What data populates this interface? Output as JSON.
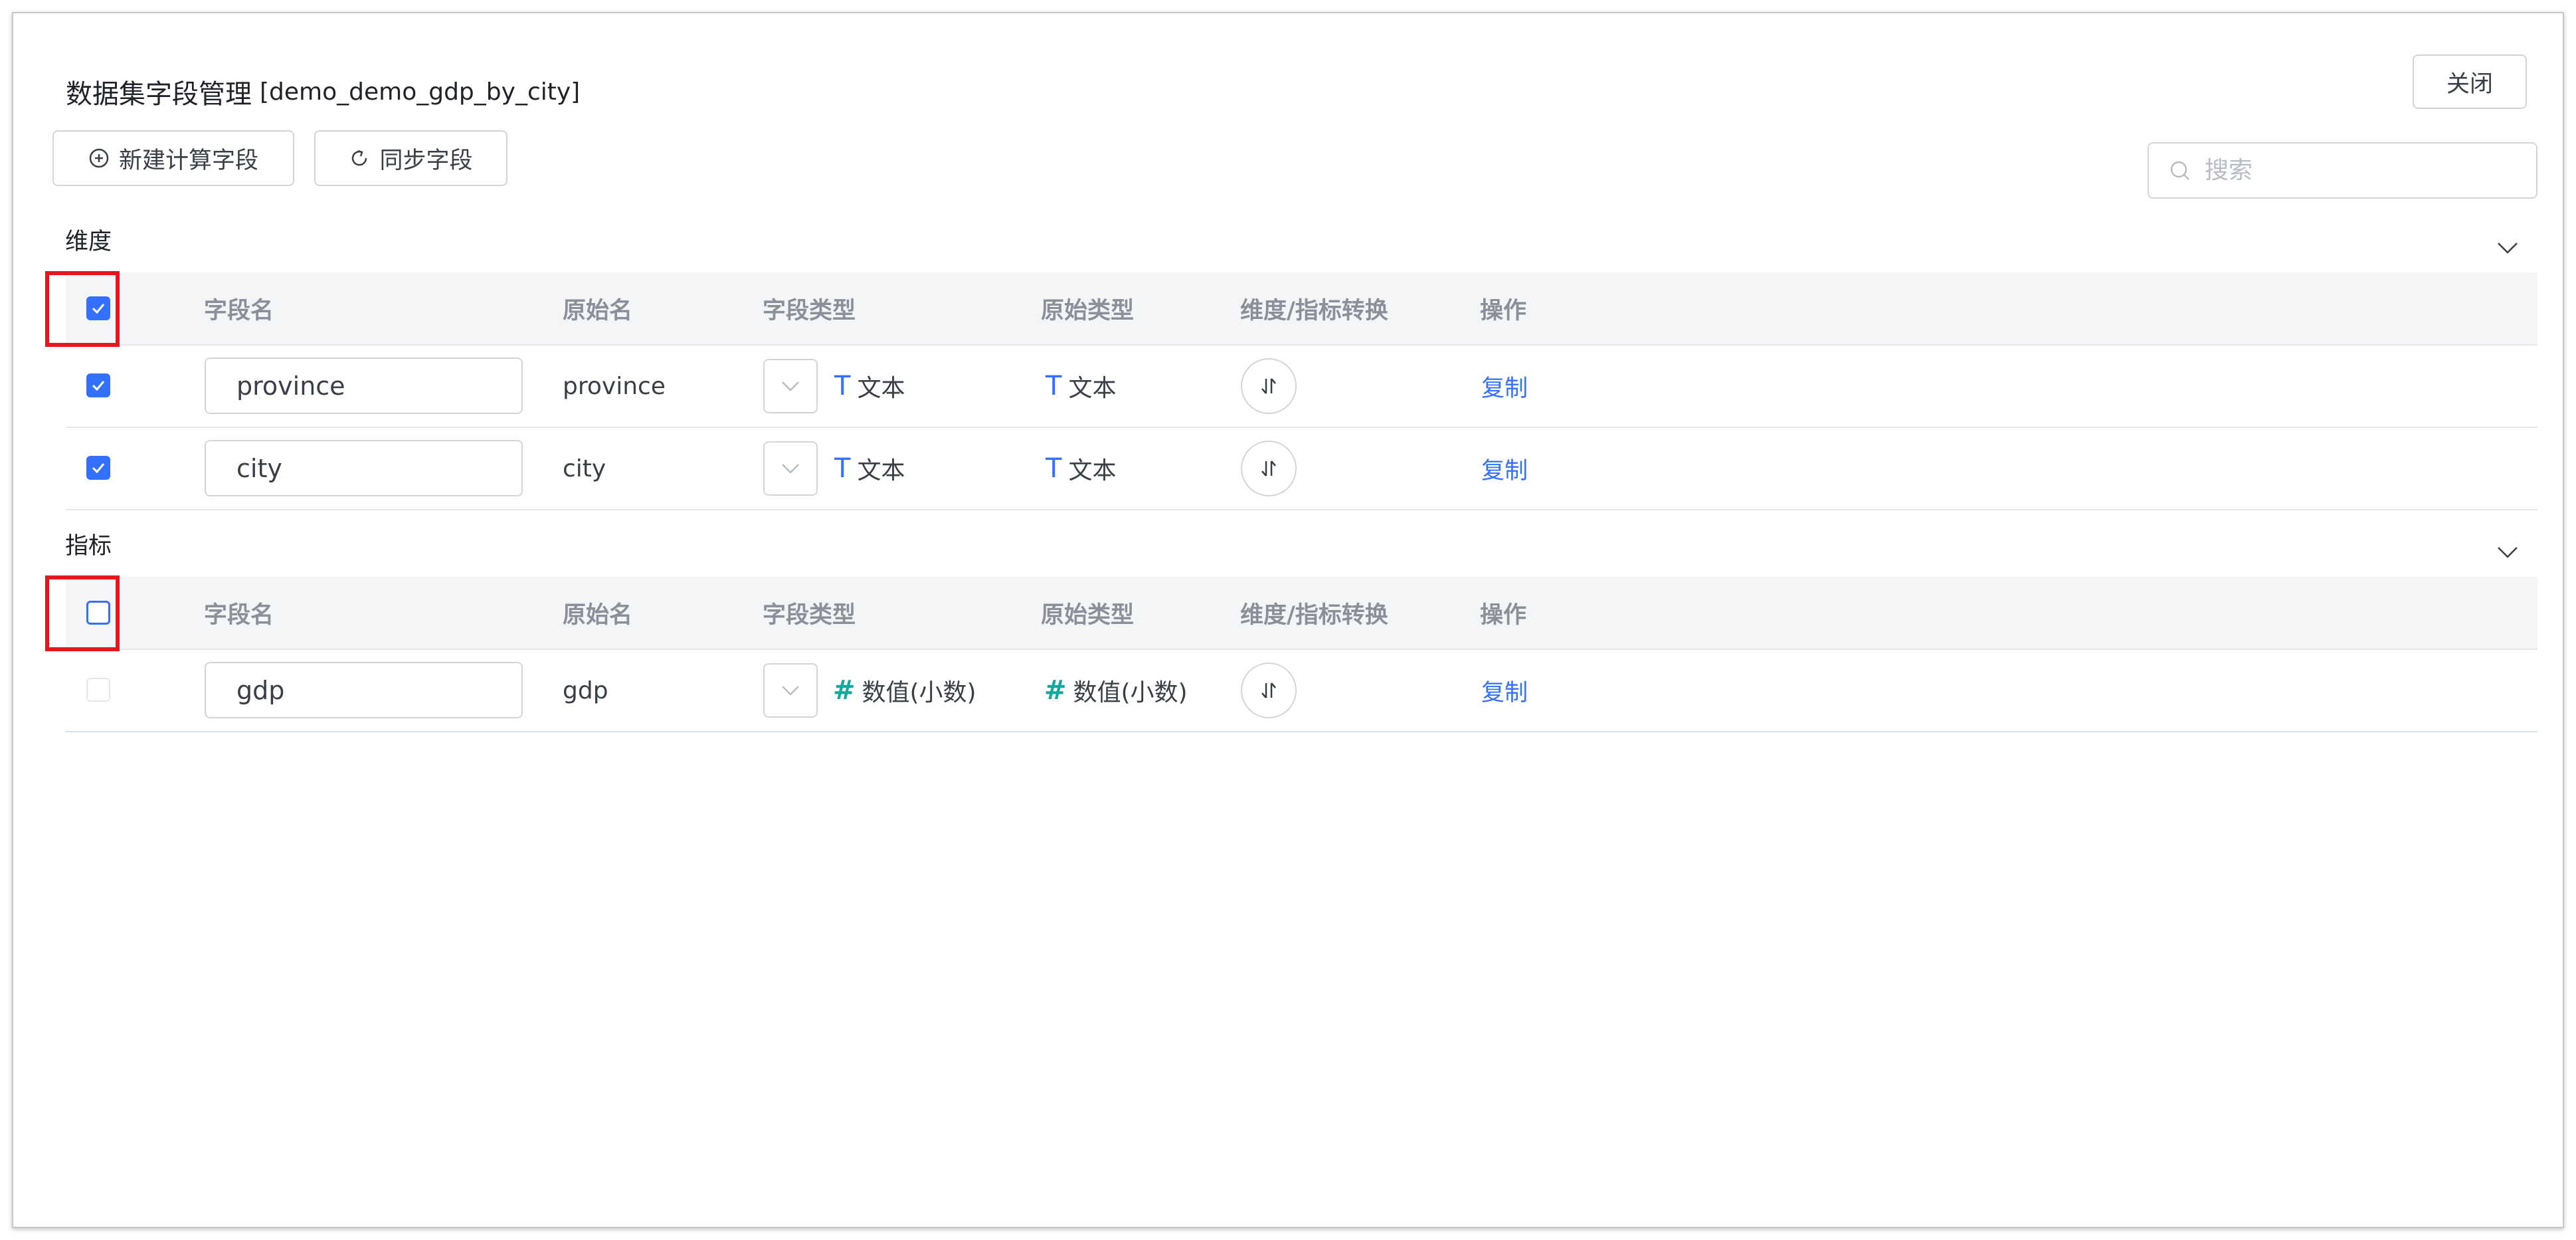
{
  "header": {
    "title": "数据集字段管理",
    "dataset": "[demo_demo_gdp_by_city]",
    "close_label": "关闭"
  },
  "toolbar": {
    "new_calc_field_label": "新建计算字段",
    "sync_fields_label": "同步字段"
  },
  "search": {
    "placeholder": "搜索",
    "value": ""
  },
  "columns": [
    "字段名",
    "原始名",
    "字段类型",
    "原始类型",
    "维度/指标转换",
    "操作"
  ],
  "dimensions": {
    "title": "维度",
    "header_checked": true,
    "rows": [
      {
        "checked": true,
        "name": "province",
        "origin_name": "province",
        "field_type_icon": "T",
        "field_type": "文本",
        "origin_type_icon": "T",
        "origin_type": "文本",
        "action": "复制"
      },
      {
        "checked": true,
        "name": "city",
        "origin_name": "city",
        "field_type_icon": "T",
        "field_type": "文本",
        "origin_type_icon": "T",
        "origin_type": "文本",
        "action": "复制"
      }
    ]
  },
  "metrics": {
    "title": "指标",
    "header_checked": false,
    "rows": [
      {
        "checked": false,
        "name": "gdp",
        "origin_name": "gdp",
        "field_type_icon": "#",
        "field_type": "数值(小数)",
        "origin_type_icon": "#",
        "origin_type": "数值(小数)",
        "action": "复制"
      }
    ]
  },
  "icons": {
    "new_calc": "plus-circle-icon",
    "sync": "refresh-icon",
    "search": "search-icon",
    "collapse": "chevron-down-icon",
    "convert": "swap-icon",
    "dropdown": "chevron-down-icon"
  },
  "colors": {
    "accent": "#3370ff",
    "highlight": "#e5161c",
    "number_type": "#13a89e"
  }
}
